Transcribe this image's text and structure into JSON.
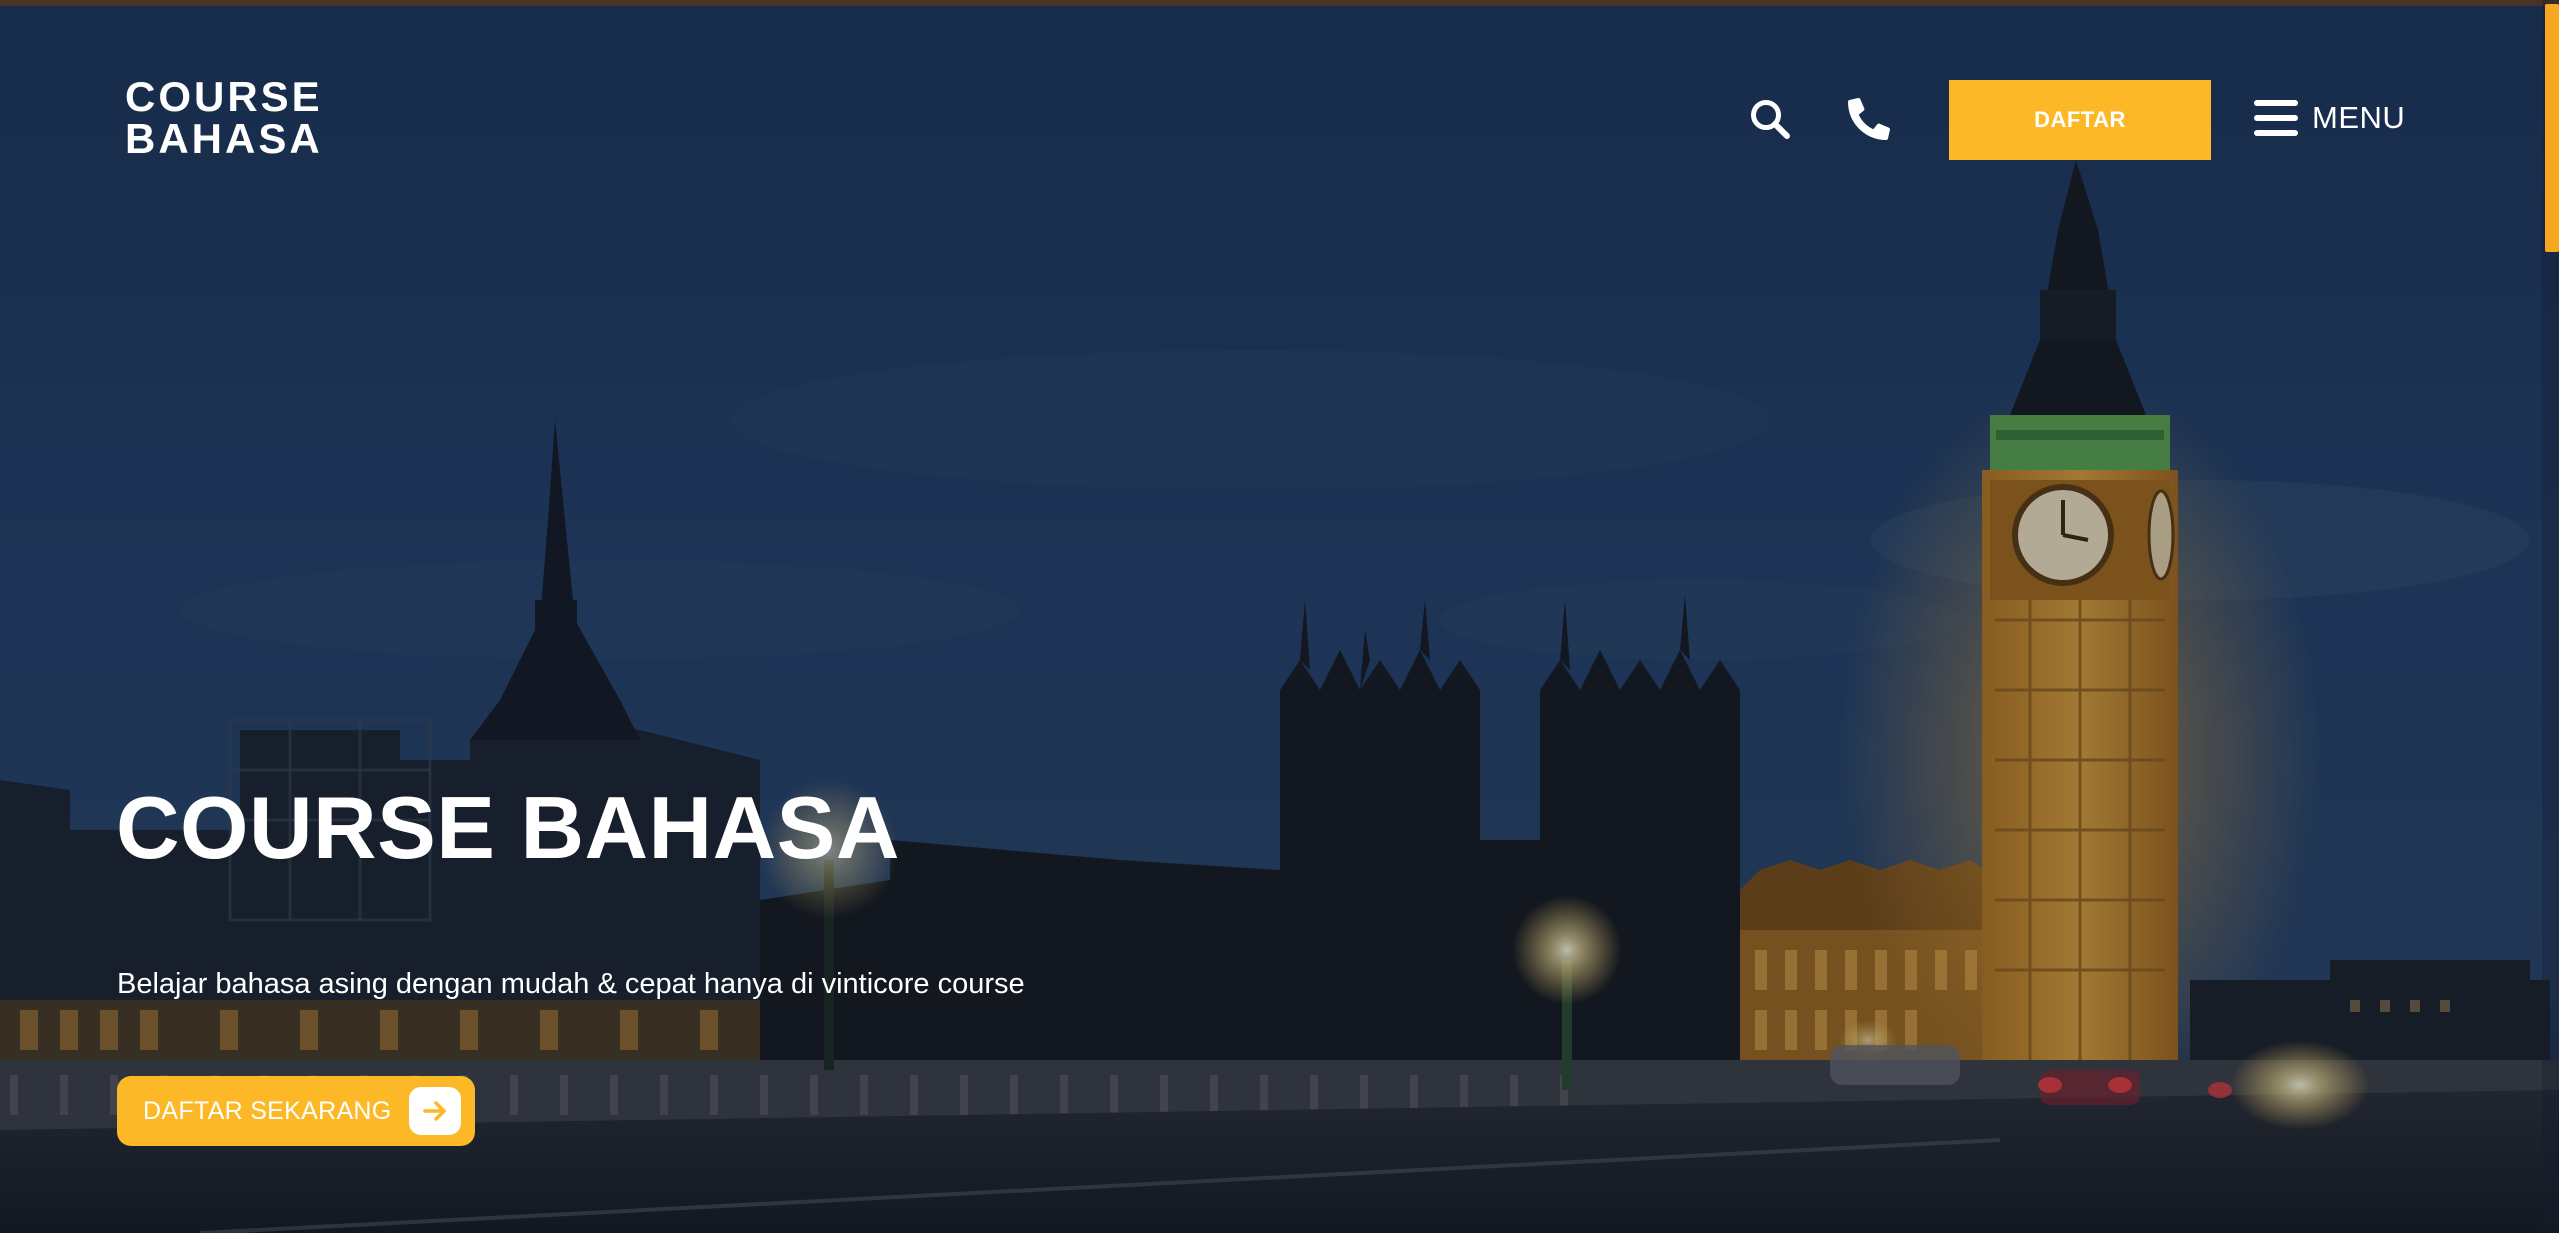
{
  "brand": {
    "logo_line1": "COURSE",
    "logo_line2": "BAHASA"
  },
  "header": {
    "search_icon": "search-icon",
    "phone_icon": "phone-icon",
    "register_label": "DAFTAR",
    "menu_label": "MENU",
    "menu_icon": "hamburger-icon"
  },
  "hero": {
    "title": "COURSE BAHASA",
    "subtitle": "Belajar bahasa asing dengan mudah & cepat hanya di vinticore course",
    "cta_label": "DAFTAR SEKARANG",
    "cta_icon": "arrow-right-icon",
    "background": "night view of Big Ben and Westminster Palace from bridge"
  },
  "colors": {
    "accent": "#fcb826",
    "scroll_thumb": "#f7a821",
    "sky": "#1e3658",
    "text": "#ffffff"
  }
}
